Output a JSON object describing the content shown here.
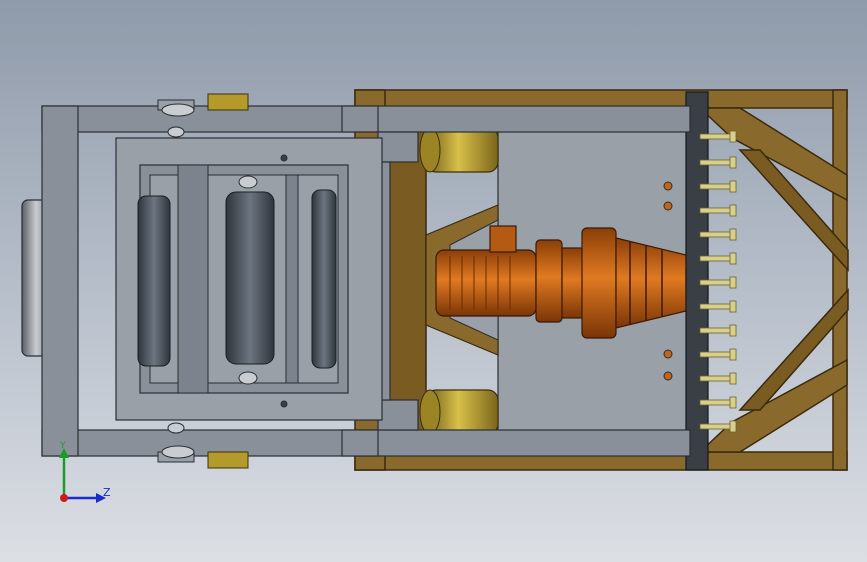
{
  "view": {
    "background_top": "#8f9aaa",
    "background_bottom": "#dcdfe4"
  },
  "colors": {
    "frame_steel": "#8a9099",
    "frame_outline": "#2a2e33",
    "wood_base": "#8a6a2c",
    "brass_tank": "#b49a2a",
    "roller": "#4f5761",
    "motor": "#c46414",
    "plate": "#9aa0a8",
    "flange": "#3a3f46",
    "bolt": "#d7cf8a"
  },
  "triad": {
    "y_label": "Y",
    "z_label": "Z",
    "y_color": "#1a9a2a",
    "z_color": "#1a2bd0",
    "origin_color": "#d01a1a",
    "icon": "coordinate-triad-icon"
  }
}
